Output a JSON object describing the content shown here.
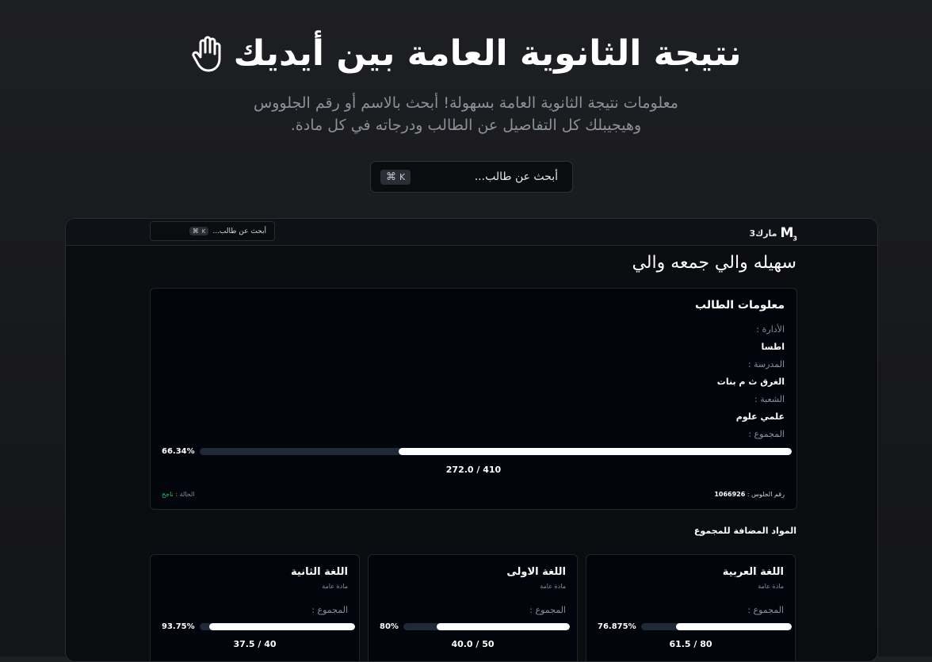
{
  "hero": {
    "title": "نتيجة الثانوية العامة بين أيديك",
    "icon": "hand-raised-icon",
    "subtitle_line1": "معلومات نتيجة الثانوية العامة بسهولة! أبحث بالاسم أو رقم الجلووس",
    "subtitle_line2": "وهيجيبلك كل التفاصيل عن الطالب ودرجاته في كل مادة.",
    "search_placeholder": "أبحث عن طالب...",
    "shortcut_symbol": "⌘",
    "shortcut_key": "K"
  },
  "preview": {
    "brand_name": "مارك3",
    "brand_logo": "M",
    "brand_logo_sub": "3",
    "search_placeholder": "أبحث عن طالب...",
    "shortcut_symbol": "⌘",
    "shortcut_key": "K",
    "student_name": "سهيله والي جمعه والي",
    "info_card": {
      "title": "معلومات الطالب",
      "administration_label": "الأدارة :",
      "administration_value": "اطسا",
      "school_label": "المدرسة :",
      "school_value": "الغرق ث م بنات",
      "division_label": "الشعبة :",
      "division_value": "علمي علوم",
      "total_label": "المجموع :",
      "total_percent_text": "66.34%",
      "total_fraction": 0.6634,
      "total_score": "272.0 / 410",
      "seat_label": "رقم الجلوس :",
      "seat_value": "1066926",
      "status_label": "الحالة :",
      "status_value": "ناجح",
      "status_color": "#22c55e"
    },
    "added_subjects_title": "المواد المضافة للمجموع",
    "subjects": [
      {
        "name": "اللغة العربية",
        "type": "مادة عامة",
        "total_label": "المجموع :",
        "percent_text": "76.875%",
        "fraction": 0.76875,
        "score": "61.5 / 80"
      },
      {
        "name": "اللغة الاولى",
        "type": "مادة عامة",
        "total_label": "المجموع :",
        "percent_text": "80%",
        "fraction": 0.8,
        "score": "40.0 / 50"
      },
      {
        "name": "اللغة الثانية",
        "type": "مادة عامة",
        "total_label": "المجموع :",
        "percent_text": "93.75%",
        "fraction": 0.9375,
        "score": "37.5 / 40"
      }
    ]
  },
  "colors": {
    "background": "#1a1b1e",
    "card_background": "#03050c",
    "progress_fill": "#ffffff",
    "progress_track": "#1f2937",
    "muted_text": "#8a8e97"
  }
}
